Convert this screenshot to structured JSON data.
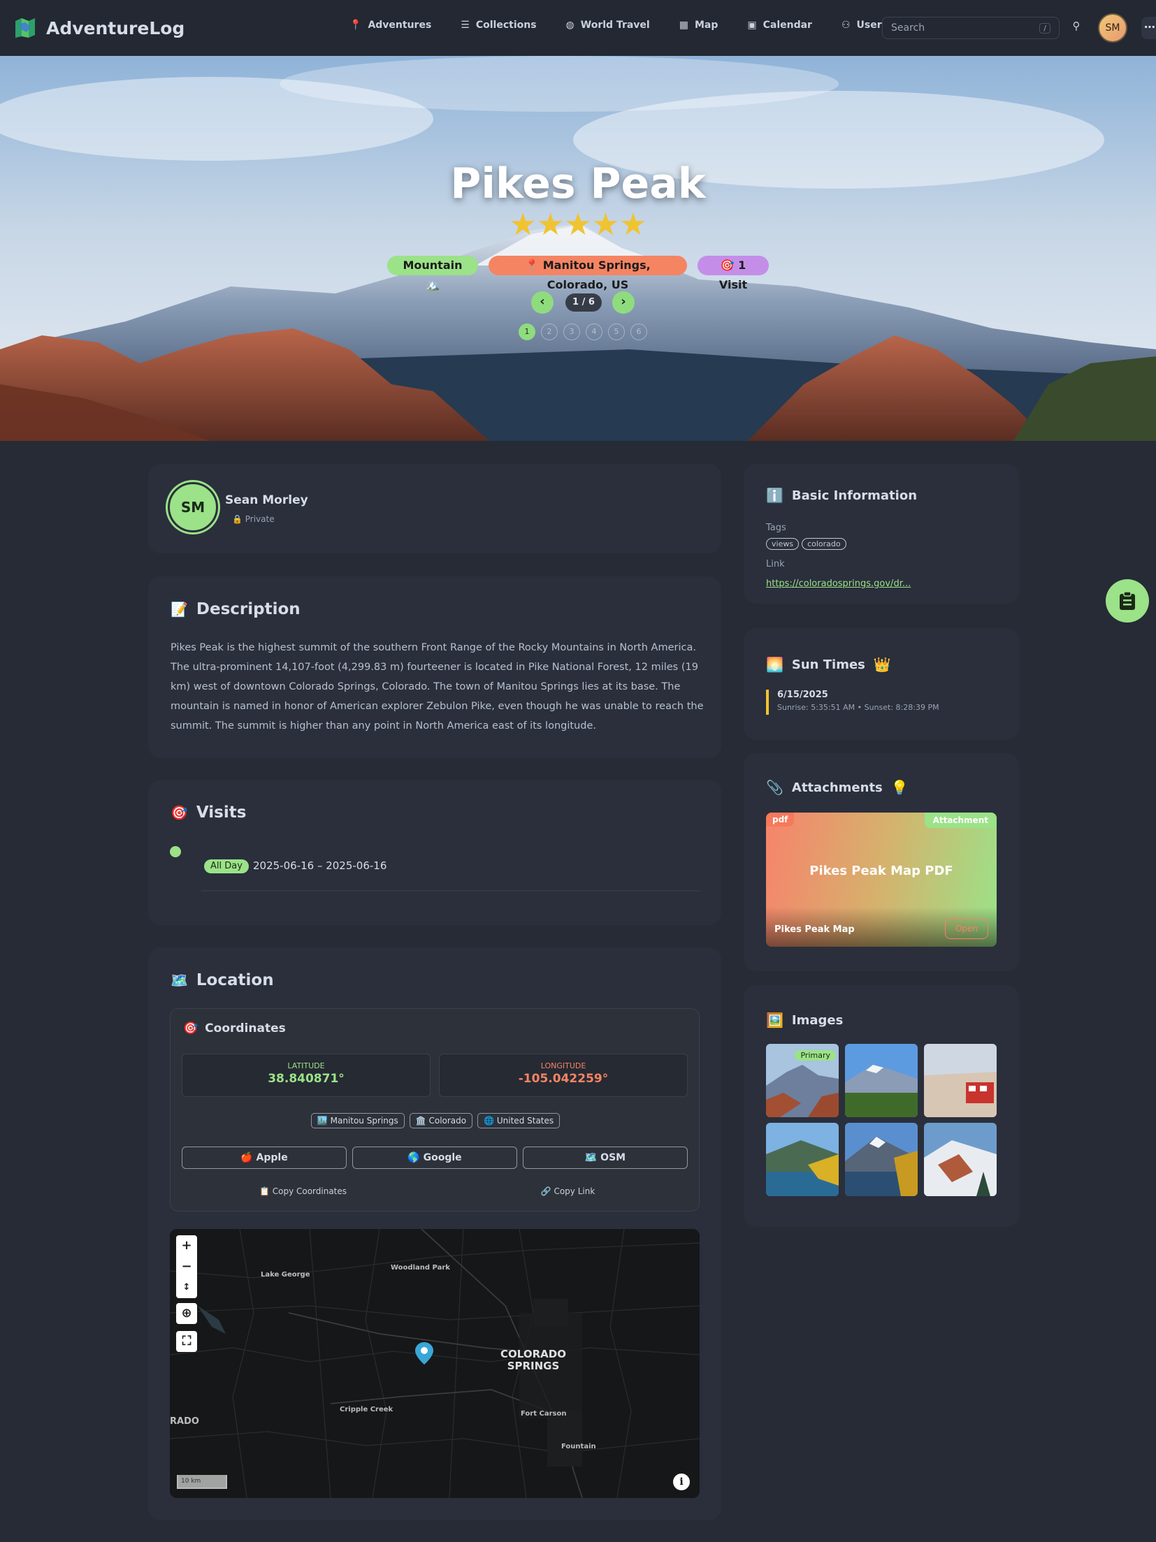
{
  "nav": {
    "brand": "AdventureLog",
    "links": [
      {
        "label": "Adventures",
        "icon": "pin-icon"
      },
      {
        "label": "Collections",
        "icon": "list-icon"
      },
      {
        "label": "World Travel",
        "icon": "globe-icon"
      },
      {
        "label": "Map",
        "icon": "map-icon"
      },
      {
        "label": "Calendar",
        "icon": "calendar-icon"
      },
      {
        "label": "Users",
        "icon": "users-icon"
      }
    ],
    "search_placeholder": "Search",
    "search_kbd": "/",
    "avatar": "SM",
    "more": "⋯"
  },
  "hero": {
    "title": "Pikes Peak",
    "rating": 5,
    "rating_max": 5,
    "stars": "★★★★★",
    "badges": {
      "category": "Mountain 🏔️",
      "location": "📍 Manitou Springs, Colorado, US",
      "visits": "🎯 1 Visit"
    },
    "carousel": {
      "counter": "1 / 6",
      "prev": "‹",
      "next": "›",
      "dots": [
        "1",
        "2",
        "3",
        "4",
        "5",
        "6"
      ]
    }
  },
  "owner": {
    "initials": "SM",
    "name": "Sean Morley",
    "privacy": "🔒 Private"
  },
  "description": {
    "title": "Description",
    "emoji": "📝",
    "text": "Pikes Peak is the highest summit of the southern Front Range of the Rocky Mountains in North America. The ultra-prominent 14,107-foot (4,299.83 m) fourteener is located in Pike National Forest, 12 miles (19 km) west of downtown Colorado Springs, Colorado. The town of Manitou Springs lies at its base. The mountain is named in honor of American explorer Zebulon Pike, even though he was unable to reach the summit. The summit is higher than any point in North America east of its longitude."
  },
  "visits": {
    "title": "Visits",
    "emoji": "🎯",
    "items": [
      {
        "badge": "All Day",
        "range": "2025-06-16 – 2025-06-16"
      }
    ]
  },
  "location": {
    "title": "Location",
    "emoji": "🗺️",
    "coordinates_title": "Coordinates",
    "coordinates_emoji": "🎯",
    "latitude_label": "LATITUDE",
    "latitude": "38.840871°",
    "longitude_label": "LONGITUDE",
    "longitude": "-105.042259°",
    "tags": [
      "🏙️ Manitou Springs",
      "🏛️ Colorado",
      "🌐 United States"
    ],
    "buttons": [
      "🍎 Apple",
      "🌎 Google",
      "🗺️ OSM"
    ],
    "copy_coords": "📋 Copy Coordinates",
    "copy_link": "🔗 Copy Link",
    "map": {
      "labels": {
        "lake_george": "Lake George",
        "woodland_park": "Woodland Park",
        "colorado_springs": "COLORADO SPRINGS",
        "cripple_creek": "Cripple Creek",
        "fort_carson": "Fort Carson",
        "fountain": "Fountain",
        "rado": "RADO"
      },
      "scale": "10 km",
      "zoom_in": "+",
      "zoom_out": "−",
      "compass": "↕",
      "info": "i"
    }
  },
  "basic": {
    "title": "Basic Information",
    "emoji": "ℹ️",
    "tags_label": "Tags",
    "tags": [
      "views",
      "colorado"
    ],
    "link_label": "Link",
    "link": "https://coloradosprings.gov/dr..."
  },
  "sun": {
    "title": "Sun Times",
    "emoji": "🌅",
    "title_suffix": "👑",
    "date": "6/15/2025",
    "times": "Sunrise: 5:35:51 AM • Sunset: 8:28:39 PM"
  },
  "attachments": {
    "title": "Attachments",
    "emoji": "📎",
    "title_suffix": "💡",
    "item": {
      "type": "pdf",
      "label": "Attachment",
      "name": "Pikes Peak Map PDF",
      "footer_name": "Pikes Peak Map",
      "open": "Open"
    }
  },
  "images": {
    "title": "Images",
    "emoji": "🖼️",
    "primary_label": "Primary"
  },
  "colors": {
    "accent": "#9be288",
    "orange": "#f58463",
    "purple": "#c48ee8",
    "star": "#f0c330"
  }
}
